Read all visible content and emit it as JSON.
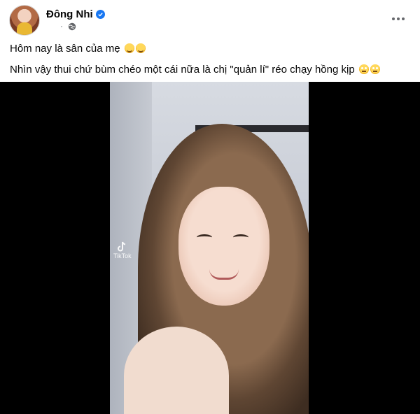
{
  "post": {
    "author": "Đông Nhi",
    "verified": true,
    "privacy_icon": "globe-icon",
    "caption_lines": [
      "Hôm nay là sân của mẹ",
      "Nhìn vậy thui chứ bùm chéo một cái nữa là chị \"quản lí\" réo chạy hồng kịp"
    ]
  },
  "video": {
    "watermark": "TikTok"
  },
  "colors": {
    "verified": "#1877f2",
    "meta": "#65676b",
    "video_bg": "#000000"
  }
}
